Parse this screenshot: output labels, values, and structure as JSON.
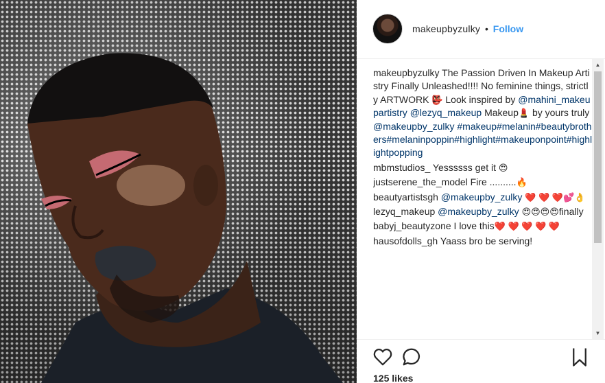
{
  "post": {
    "username": "makeupbyzulky",
    "separator": "•",
    "follow_label": "Follow",
    "likes": "125 likes"
  },
  "caption": {
    "user": "makeupbyzulky",
    "line1": " The Passion Driven In Makeup Artistry Finally Unleashed!!!! No feminine things, strictly ARTWORK ",
    "emoji1": "👺",
    "line2": " Look inspired by ",
    "mention1": "@mahini_makeupartistry",
    "space": " ",
    "mention2": "@lezyq_makeup",
    "line3": " Makeup",
    "emoji2": "💄",
    "line4": " by yours truly ",
    "mention3": "@makeupby_zulky",
    "hashtags": " #makeup#melanin#beautybrothers#melaninpoppin#highlight#makeuponpoint#highlightpopping"
  },
  "comments": [
    {
      "user": "mbmstudios_",
      "text": " Yessssss get it ",
      "emoji": "😍"
    },
    {
      "user": "justserene_the_model",
      "text": " Fire ..........",
      "emoji": "🔥"
    },
    {
      "user": "beautyartistsgh",
      "mention": " @makeupby_zulky",
      "text": " ",
      "emoji": "❤️ ❤️ ❤️💕👌"
    },
    {
      "user": "lezyq_makeup",
      "mention": " @makeupby_zulky",
      "text": " ",
      "emoji": "😍😍😍😍",
      "suffix": "finally"
    },
    {
      "user": "babyj_beautyzone",
      "text": " I love this",
      "emoji": "❤️ ❤️ ❤️ ❤️ ❤️"
    },
    {
      "user": "hausofdolls_gh",
      "text": " Yaass bro be serving!"
    }
  ],
  "icons": {
    "like": "heart-icon",
    "comment": "comment-bubble-icon",
    "save": "bookmark-icon",
    "scroll_up": "▲",
    "scroll_down": "▼"
  },
  "colors": {
    "link": "#003569",
    "follow": "#3897f0",
    "text": "#262626"
  }
}
